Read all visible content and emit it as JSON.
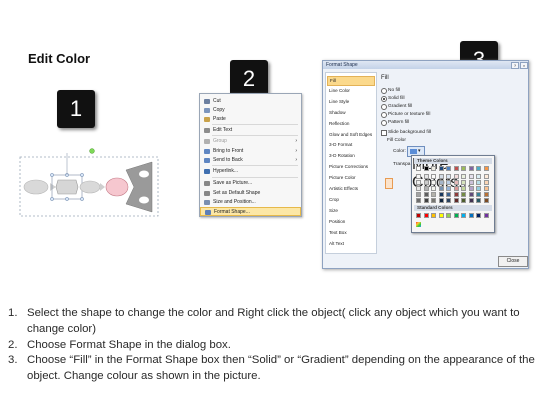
{
  "heading": "Edit Color",
  "steps_badges": [
    "1",
    "2",
    "3"
  ],
  "context_menu": {
    "items": [
      {
        "label": "Cut",
        "icon": "scissors-icon",
        "color": "#6b7fa0"
      },
      {
        "label": "Copy",
        "icon": "copy-icon",
        "color": "#7c95bd"
      },
      {
        "label": "Paste",
        "icon": "paste-icon",
        "color": "#c9a24a"
      },
      {
        "label": "Edit Text",
        "icon": "text-icon",
        "color": "#8c8c8c"
      },
      {
        "label": "Group",
        "icon": "group-icon",
        "color": "#b0b0b0",
        "submenu": true,
        "disabled": true
      },
      {
        "label": "Bring to Front",
        "icon": "bring-front-icon",
        "color": "#5f86c2",
        "submenu": true
      },
      {
        "label": "Send to Back",
        "icon": "send-back-icon",
        "color": "#5f86c2",
        "submenu": true
      },
      {
        "label": "Hyperlink...",
        "icon": "hyperlink-icon",
        "color": "#3f6fb0"
      },
      {
        "label": "Save as Picture...",
        "icon": "save-picture-icon",
        "color": "#888888"
      },
      {
        "label": "Set as Default Shape",
        "icon": "default-shape-icon",
        "color": "#888888"
      },
      {
        "label": "Size and Position...",
        "icon": "size-position-icon",
        "color": "#7a8fb0"
      },
      {
        "label": "Format Shape...",
        "icon": "format-shape-icon",
        "color": "#5d7fb8",
        "highlighted": true
      }
    ]
  },
  "dialog": {
    "title": "Format Shape",
    "categories": [
      "Fill",
      "Line Color",
      "Line Style",
      "Shadow",
      "Reflection",
      "Glow and Soft Edges",
      "3-D Format",
      "3-D Rotation",
      "Picture Corrections",
      "Picture Color",
      "Artistic Effects",
      "Crop",
      "Size",
      "Position",
      "Text Box",
      "Alt Text"
    ],
    "section_title": "Fill",
    "fill_options": [
      {
        "label": "No fill",
        "selected": false
      },
      {
        "label": "Solid fill",
        "selected": true
      },
      {
        "label": "Gradient fill",
        "selected": false
      },
      {
        "label": "Picture or texture fill",
        "selected": false
      },
      {
        "label": "Pattern fill",
        "selected": false
      }
    ],
    "slide_background_label": "Slide background fill",
    "fill_color_label": "Fill Color",
    "color_label": "Color:",
    "transparency_label": "Transpa",
    "close_button": "Close",
    "palette": {
      "theme_title": "Theme Colors",
      "standard_title": "Standard Colors",
      "more_colors": "More Colors...",
      "theme_top": [
        "#ffffff",
        "#000000",
        "#eeece1",
        "#1f497d",
        "#4f81bd",
        "#c0504d",
        "#9bbb59",
        "#8064a2",
        "#4bacc6",
        "#f79646"
      ],
      "standard": [
        "#c00000",
        "#ff0000",
        "#ffc000",
        "#ffff00",
        "#92d050",
        "#00b050",
        "#00b0f0",
        "#0070c0",
        "#002060",
        "#7030a0"
      ]
    }
  },
  "instructions": [
    {
      "num": "1.",
      "text": "Select the shape to change the color and Right click the object( click any object which you want to change color)"
    },
    {
      "num": "2.",
      "text": "Choose Format Shape in the dialog box."
    },
    {
      "num": "3.",
      "text": "Choose “Fill” in the Format Shape box then “Solid” or “Gradient” depending on the appearance of the object. Change colour as shown in the picture."
    }
  ]
}
